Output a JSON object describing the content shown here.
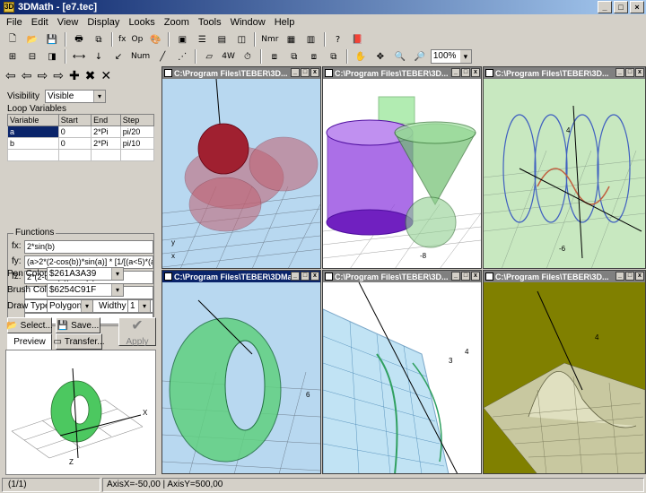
{
  "window": {
    "title": "3DMath - [e7.tec]"
  },
  "menu": [
    "File",
    "Edit",
    "View",
    "Display",
    "Looks",
    "Zoom",
    "Tools",
    "Window",
    "Help"
  ],
  "toolbar": {
    "fx": "fx",
    "op": "Op",
    "nmr": "Nmr",
    "num": "Num",
    "fw": "4W",
    "zoom": "100%"
  },
  "panel": {
    "visibility_label": "Visibility",
    "visibility_value": "Visible",
    "loop_label": "Loop Variables",
    "loop_headers": [
      "Variable",
      "Start",
      "End",
      "Step"
    ],
    "loop_rows": [
      [
        "a",
        "0",
        "2*Pi",
        "pi/20"
      ],
      [
        "b",
        "0",
        "2*Pi",
        "pi/10"
      ]
    ],
    "functions_label": "Functions",
    "fx_label": "fx:",
    "fx_value": "2*sin(b)",
    "fy_label": "fy:",
    "fy_value": "(a>2*(2-cos(b))*sin(a)] * [1/[(a<5)*(a>-5)]]",
    "fz_label": "fz:",
    "fz_value": "2*(2-cos(b))*cos(a)",
    "pen_label": "Pen Color",
    "pen_value": "$261A3A39",
    "brush_label": "Brush Color",
    "brush_value": "$6254C91F",
    "draw_label": "Draw Type",
    "draw_value": "Polygon",
    "width_label": "Widthy",
    "width_value": "1",
    "select_button": "Select...",
    "save_button": "Save...",
    "apply_button": "Apply",
    "tab_preview": "Preview",
    "transfer_button": "Transfer..."
  },
  "windows": [
    {
      "title": "C:\\Program Files\\TEBER\\3D..."
    },
    {
      "title": "C:\\Program Files\\TEBER\\3D..."
    },
    {
      "title": "C:\\Program Files\\TEBER\\3D..."
    },
    {
      "title": "C:\\Program Files\\TEBER\\3DMa..."
    },
    {
      "title": "C:\\Program Files\\TEBER\\3D..."
    },
    {
      "title": "C:\\Program Files\\TEBER\\3D..."
    }
  ],
  "axis_labels": {
    "w2_neg8": "-8",
    "w3_4": "4",
    "w3_neg6": "-6",
    "w5_4": "4",
    "w5_3": "3",
    "w4_6": "6",
    "w6_4": "4"
  },
  "status": {
    "page": "(1/1)",
    "axis": "AxisX=-50,00 | AxisY=500,00"
  },
  "colors": {
    "titlebar": "#0a246a",
    "face": "#d4d0c8",
    "win6_bg": "#808000"
  }
}
